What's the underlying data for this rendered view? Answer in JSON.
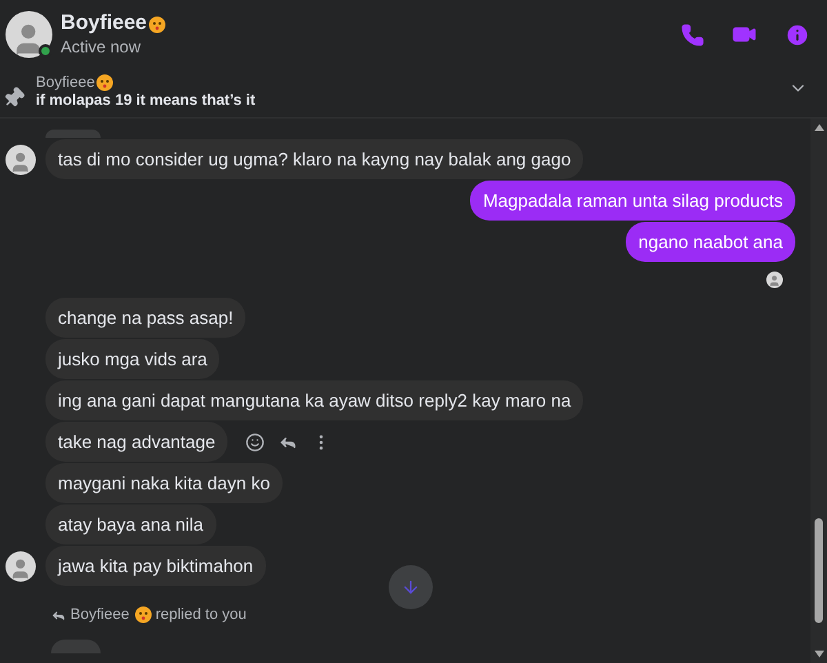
{
  "header": {
    "name": "Boyfieee",
    "status": "Active now",
    "online": true
  },
  "pinned": {
    "sender": "Boyfieee",
    "text": "if molapas 19 it means that’s it"
  },
  "messages": [
    {
      "kind": "incoming",
      "text": "tas di mo consider ug ugma? klaro na kayng nay balak ang gago",
      "avatar": true,
      "actions": false
    },
    {
      "kind": "outgoing",
      "text": "Magpadala raman unta silag products"
    },
    {
      "kind": "outgoing",
      "text": "ngano naabot ana"
    },
    {
      "kind": "seen",
      "avatar": true
    },
    {
      "kind": "incoming",
      "text": "change na pass asap!",
      "avatar": false,
      "actions": false
    },
    {
      "kind": "incoming",
      "text": "jusko mga vids ara",
      "avatar": false,
      "actions": false
    },
    {
      "kind": "incoming",
      "text": "ing ana gani dapat mangutana ka ayaw ditso reply2 kay maro na",
      "avatar": false,
      "actions": false
    },
    {
      "kind": "incoming",
      "text": "take nag advantage",
      "avatar": false,
      "actions": true
    },
    {
      "kind": "incoming",
      "text": "maygani naka kita dayn ko",
      "avatar": false,
      "actions": false
    },
    {
      "kind": "incoming",
      "text": "atay baya ana nila",
      "avatar": false,
      "actions": false
    },
    {
      "kind": "incoming",
      "text": "jawa kita pay biktimahon",
      "avatar": true,
      "actions": false
    }
  ],
  "reply_notice": {
    "sender": "Boyfieee",
    "text": "replied to you"
  }
}
